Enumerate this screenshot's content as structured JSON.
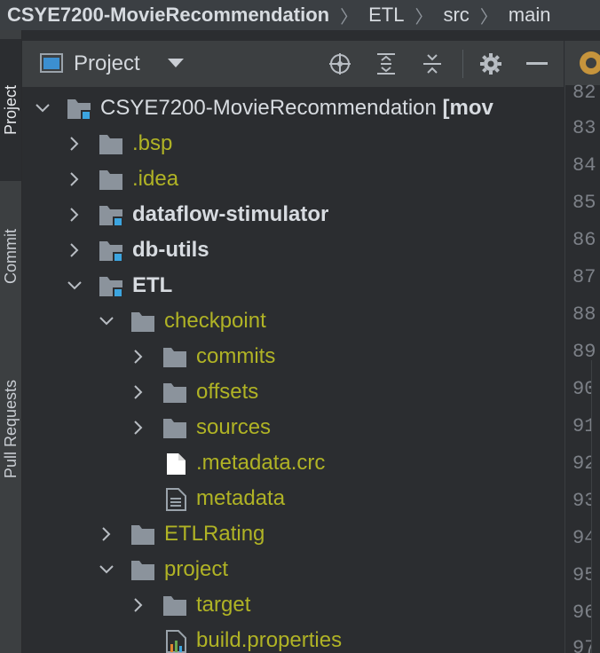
{
  "breadcrumb": [
    "CSYE7200-MovieRecommendation",
    "ETL",
    "src",
    "main"
  ],
  "sidebar": {
    "tabs": [
      {
        "label": "Project"
      },
      {
        "label": "Commit"
      },
      {
        "label": "Pull Requests"
      }
    ]
  },
  "panel": {
    "title": "Project",
    "buttons": [
      "locate-icon",
      "expand-all-icon",
      "collapse-all-icon",
      "gear-icon",
      "minimize-icon"
    ]
  },
  "tree": [
    {
      "label": "CSYE7200-MovieRecommendation",
      "suffix": "[mov",
      "depth": 0,
      "expanded": true,
      "type": "module-root"
    },
    {
      "label": ".bsp",
      "depth": 1,
      "expanded": false,
      "type": "folder",
      "color": "yellow"
    },
    {
      "label": ".idea",
      "depth": 1,
      "expanded": false,
      "type": "folder",
      "color": "yellow"
    },
    {
      "label": "dataflow-stimulator",
      "depth": 1,
      "expanded": false,
      "type": "module",
      "color": "white"
    },
    {
      "label": "db-utils",
      "depth": 1,
      "expanded": false,
      "type": "module",
      "color": "white"
    },
    {
      "label": "ETL",
      "depth": 1,
      "expanded": true,
      "type": "module",
      "color": "white"
    },
    {
      "label": "checkpoint",
      "depth": 2,
      "expanded": true,
      "type": "folder",
      "color": "yellow"
    },
    {
      "label": "commits",
      "depth": 3,
      "expanded": false,
      "type": "folder",
      "color": "yellow"
    },
    {
      "label": "offsets",
      "depth": 3,
      "expanded": false,
      "type": "folder",
      "color": "yellow"
    },
    {
      "label": "sources",
      "depth": 3,
      "expanded": false,
      "type": "folder",
      "color": "yellow"
    },
    {
      "label": ".metadata.crc",
      "depth": 3,
      "type": "file",
      "color": "yellow"
    },
    {
      "label": "metadata",
      "depth": 3,
      "type": "textfile",
      "color": "yellow"
    },
    {
      "label": "ETLRating",
      "depth": 2,
      "expanded": false,
      "type": "folder",
      "color": "yellow"
    },
    {
      "label": "project",
      "depth": 2,
      "expanded": true,
      "type": "folder",
      "color": "yellow"
    },
    {
      "label": "target",
      "depth": 3,
      "expanded": false,
      "type": "folder",
      "color": "yellow"
    },
    {
      "label": "build.properties",
      "depth": 3,
      "type": "properties",
      "color": "yellow"
    }
  ],
  "editor": {
    "line_numbers": [
      "82",
      "83",
      "84",
      "85",
      "86",
      "87",
      "88",
      "89",
      "90",
      "91",
      "92",
      "93",
      "94",
      "95",
      "96",
      "97"
    ]
  },
  "colors": {
    "folder": "#8b939c",
    "module_badge": "#3ca5e0",
    "ignored_text": "#b0b325"
  }
}
